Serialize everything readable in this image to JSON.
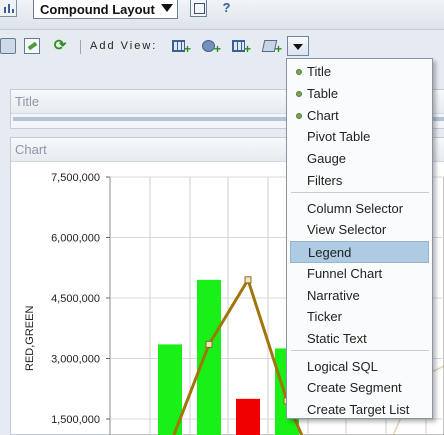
{
  "toolbar": {
    "layout_select_value": "Compound Layout",
    "properties_icon": "properties-icon",
    "help_icon": "help-icon",
    "help_glyph": "?"
  },
  "toolbar2": {
    "add_view_label": "Add View:",
    "icons": [
      "chart-options-icon",
      "edit-icon",
      "refresh-icon"
    ],
    "add_view_icons": [
      "add-table-icon",
      "add-chart-icon",
      "add-pivot-icon",
      "add-filter-icon"
    ]
  },
  "panes": {
    "title_label": "Title",
    "chart_label": "Chart"
  },
  "chart_data": {
    "type": "bar",
    "ylabel": "RED,GREEN",
    "y_ticks": [
      "7,500,000",
      "6,000,000",
      "4,500,000",
      "3,000,000",
      "1,500,000"
    ],
    "ylim": [
      0,
      7500000
    ],
    "series": [
      {
        "name": "green",
        "color": "#18f018",
        "values": [
          3350000,
          4950000,
          null,
          3250000
        ]
      },
      {
        "name": "red",
        "color": "#f00000",
        "values": [
          null,
          null,
          2000000,
          null
        ]
      },
      {
        "name": "line",
        "color": "#a0750a",
        "values": [
          null,
          3350000,
          4950000,
          1950000
        ]
      }
    ],
    "grid": true
  },
  "menu": {
    "groups": [
      [
        {
          "label": "Title",
          "marked": true
        },
        {
          "label": "Table",
          "marked": true
        },
        {
          "label": "Chart",
          "marked": true
        },
        {
          "label": "Pivot Table",
          "marked": false
        },
        {
          "label": "Gauge",
          "marked": false
        },
        {
          "label": "Filters",
          "marked": false
        }
      ],
      [
        {
          "label": "Column Selector",
          "marked": false
        },
        {
          "label": "View Selector",
          "marked": false
        },
        {
          "label": "Legend",
          "marked": false,
          "highlighted": true
        },
        {
          "label": "Funnel Chart",
          "marked": false
        },
        {
          "label": "Narrative",
          "marked": false
        },
        {
          "label": "Ticker",
          "marked": false
        },
        {
          "label": "Static Text",
          "marked": false
        }
      ],
      [
        {
          "label": "Logical SQL",
          "marked": false
        },
        {
          "label": "Create Segment",
          "marked": false
        },
        {
          "label": "Create Target List",
          "marked": false
        }
      ]
    ]
  },
  "colors": {
    "menu_highlight": "#aecbe3",
    "bar_green": "#18f018",
    "bar_red": "#f00000",
    "line": "#a0750a"
  }
}
